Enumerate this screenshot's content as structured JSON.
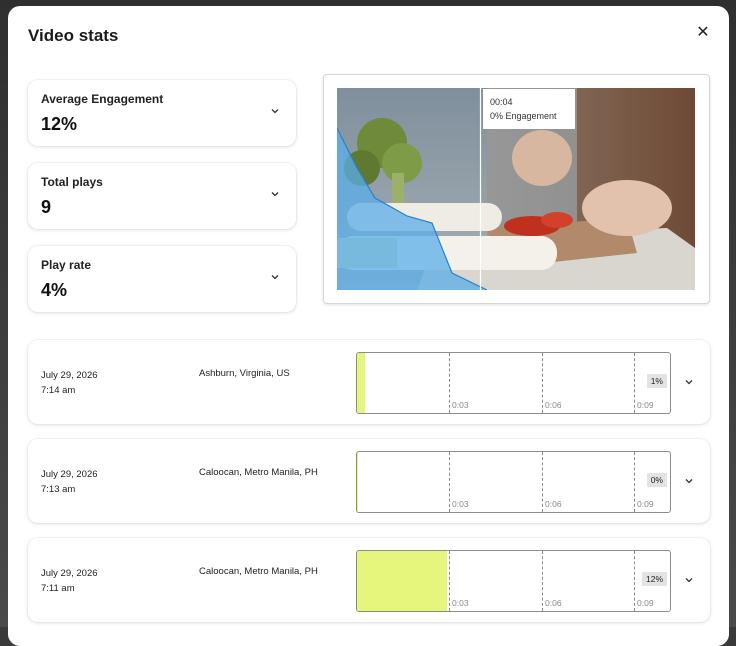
{
  "modal": {
    "title": "Video stats",
    "close_icon": "✕"
  },
  "stats": [
    {
      "label": "Average Engagement",
      "value": "12%"
    },
    {
      "label": "Total plays",
      "value": "9"
    },
    {
      "label": "Play rate",
      "value": "4%"
    }
  ],
  "preview": {
    "tooltip_time": "00:04",
    "tooltip_engagement": "0% Engagement",
    "engagement_color": "#5aaee8"
  },
  "timeline_ticks": [
    "0:03",
    "0:06",
    "0:09"
  ],
  "plays": [
    {
      "date": "July 29, 2026",
      "time": "7:14 am",
      "location": "Ashburn, Virginia, US",
      "percent": "1%",
      "fraction": 0.01
    },
    {
      "date": "July 29, 2026",
      "time": "7:13 am",
      "location": "Caloocan, Metro Manila, PH",
      "percent": "0%",
      "fraction": 0.0
    },
    {
      "date": "July 29, 2026",
      "time": "7:11 am",
      "location": "Caloocan, Metro Manila, PH",
      "percent": "12%",
      "fraction": 0.12
    }
  ],
  "colors": {
    "fill": "#e6f57b"
  }
}
